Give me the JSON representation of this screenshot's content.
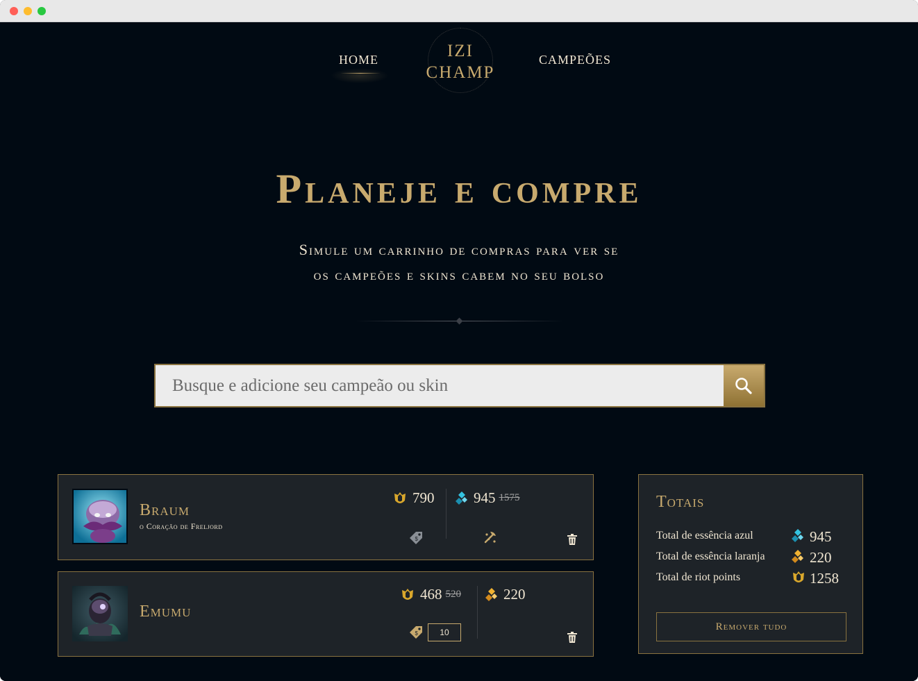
{
  "nav": {
    "home": "HOME",
    "logo_line1": "IZI",
    "logo_line2": "CHAMP",
    "champions": "CAMPEÕES"
  },
  "hero": {
    "title": "Planeje e compre",
    "subtitle_line1": "Simule um carrinho de compras para ver se",
    "subtitle_line2": "os campeões e skins cabem no seu bolso"
  },
  "search": {
    "placeholder": "Busque e adicione seu campeão ou skin"
  },
  "cart": [
    {
      "name": "Braum",
      "title": "o Coração de Freljord",
      "rp": "790",
      "blue_essence": "945",
      "blue_essence_old": "1575"
    },
    {
      "name": "Emumu",
      "rp": "468",
      "rp_old": "520",
      "orange_essence": "220",
      "discount": "10"
    }
  ],
  "totals": {
    "title": "Totais",
    "blue_label": "Total de essência azul",
    "blue_value": "945",
    "orange_label": "Total de essência laranja",
    "orange_value": "220",
    "rp_label": "Total de riot points",
    "rp_value": "1258",
    "remove_all": "Remover tudo"
  },
  "colors": {
    "background": "#010a13",
    "gold": "#c8aa6e",
    "card": "#1e2328",
    "text": "#f0e6d2",
    "blue_essence": "#0ac8b9"
  }
}
